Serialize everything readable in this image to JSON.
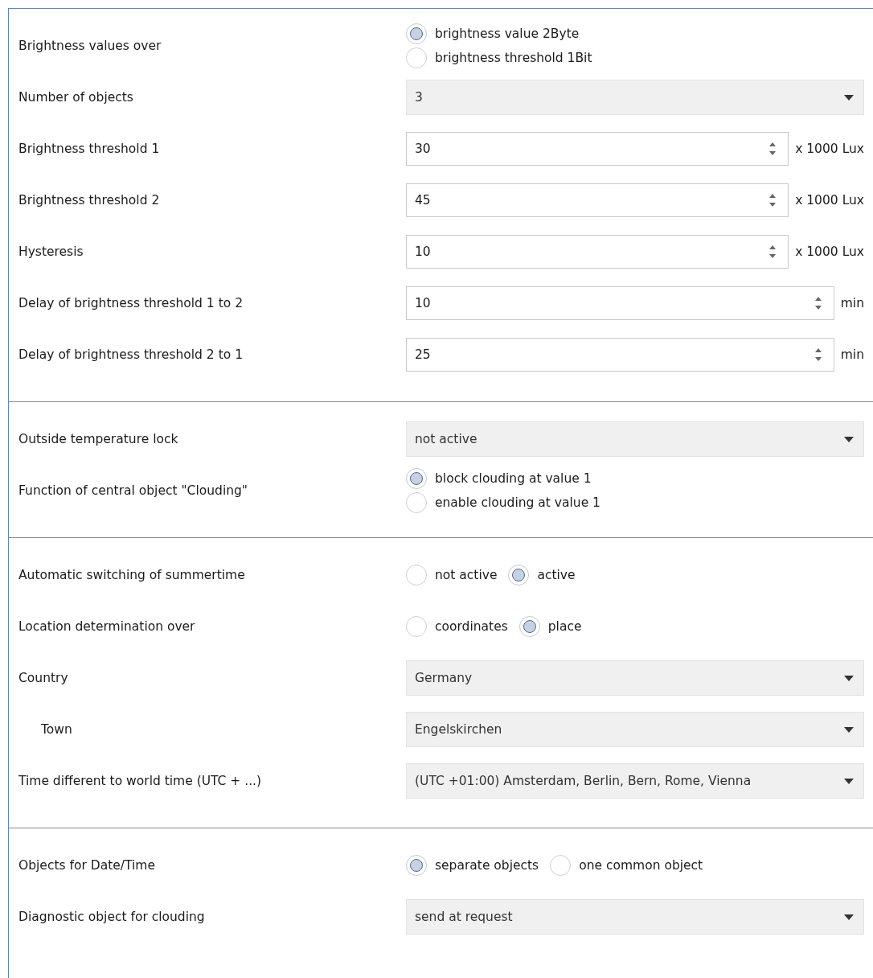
{
  "sections": [
    {
      "rows": [
        {
          "kind": "radio_stacked",
          "label": "Brightness values over",
          "options": [
            {
              "label": "brightness value 2Byte",
              "selected": true
            },
            {
              "label": "brightness threshold 1Bit",
              "selected": false
            }
          ]
        },
        {
          "kind": "select",
          "label": "Number of objects",
          "value": "3"
        },
        {
          "kind": "spin",
          "label": "Brightness threshold 1",
          "value": "30",
          "unit": "x 1000 Lux"
        },
        {
          "kind": "spin",
          "label": "Brightness threshold 2",
          "value": "45",
          "unit": "x 1000 Lux"
        },
        {
          "kind": "spin",
          "label": "Hysteresis",
          "value": "10",
          "unit": "x 1000 Lux"
        },
        {
          "kind": "spin",
          "label": "Delay of brightness threshold 1 to 2",
          "value": "10",
          "unit": "min"
        },
        {
          "kind": "spin",
          "label": "Delay of brightness threshold 2 to 1",
          "value": "25",
          "unit": "min"
        }
      ]
    },
    {
      "rows": [
        {
          "kind": "select",
          "label": "Outside temperature lock",
          "value": "not active"
        },
        {
          "kind": "radio_stacked",
          "label": "Function of central object \"Clouding\"",
          "options": [
            {
              "label": "block clouding at value 1",
              "selected": true
            },
            {
              "label": "enable clouding at value 1",
              "selected": false
            }
          ]
        }
      ]
    },
    {
      "rows": [
        {
          "kind": "radio_inline",
          "label": "Automatic switching of summertime",
          "options": [
            {
              "label": "not active",
              "selected": false
            },
            {
              "label": "active",
              "selected": true
            }
          ]
        },
        {
          "kind": "radio_inline",
          "label": "Location determination over",
          "options": [
            {
              "label": "coordinates",
              "selected": false
            },
            {
              "label": "place",
              "selected": true
            }
          ]
        },
        {
          "kind": "select",
          "label": "Country",
          "value": "Germany",
          "children": [
            {
              "kind": "select",
              "label": "Town",
              "value": "Engelskirchen"
            }
          ]
        },
        {
          "kind": "select",
          "label": "Time different to world time (UTC + ...)",
          "value": "(UTC +01:00) Amsterdam, Berlin, Bern, Rome, Vienna"
        }
      ]
    },
    {
      "rows": [
        {
          "kind": "radio_inline",
          "label": "Objects for Date/Time",
          "options": [
            {
              "label": "separate objects",
              "selected": true
            },
            {
              "label": "one common object",
              "selected": false
            }
          ]
        },
        {
          "kind": "select",
          "label": "Diagnostic object for clouding",
          "value": "send at request"
        }
      ]
    }
  ]
}
